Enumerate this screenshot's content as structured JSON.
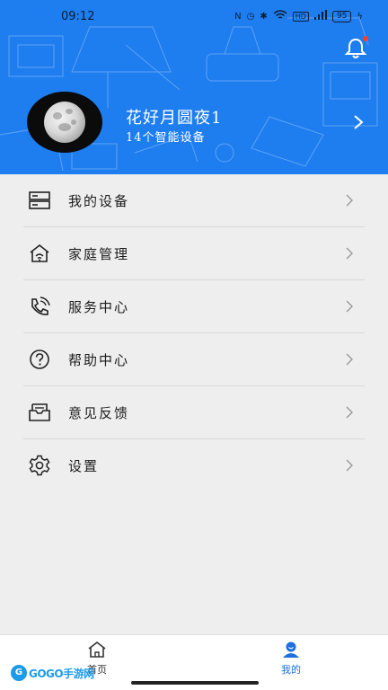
{
  "status_bar": {
    "time": "09:12",
    "icons": [
      "nfc-icon",
      "alarm-icon",
      "bluetooth-icon",
      "wifi-icon",
      "hd-icon",
      "signal-icon"
    ],
    "battery": "95"
  },
  "header": {
    "background_color": "#1e7ef0",
    "user_name": "花好月圆夜1",
    "device_count_text": "14个智能设备",
    "has_notification": true
  },
  "menu": {
    "items": [
      {
        "label": "我的设备",
        "icon": "device-server-icon"
      },
      {
        "label": "家庭管理",
        "icon": "home-wifi-icon"
      },
      {
        "label": "服务中心",
        "icon": "phone-service-icon"
      },
      {
        "label": "帮助中心",
        "icon": "help-question-icon"
      },
      {
        "label": "意见反馈",
        "icon": "feedback-mail-icon"
      },
      {
        "label": "设置",
        "icon": "settings-gear-icon"
      }
    ]
  },
  "bottom_nav": {
    "tabs": [
      {
        "label": "首页",
        "icon": "home-icon",
        "active": false
      },
      {
        "label": "我的",
        "icon": "profile-icon",
        "active": true
      }
    ],
    "active_color": "#1e6fe0"
  },
  "watermark": {
    "logo_text": "GOGO手游网"
  }
}
